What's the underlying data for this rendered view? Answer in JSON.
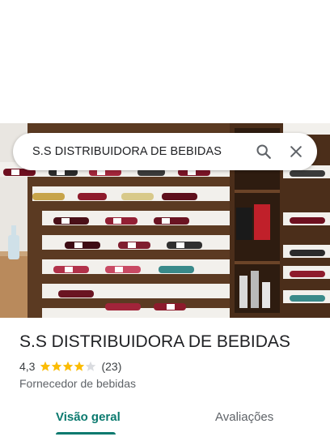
{
  "search": {
    "query": "S.S DISTRIBUIDORA DE BEBIDAS"
  },
  "place": {
    "name": "S.S DISTRIBUIDORA DE BEBIDAS",
    "rating": "4,3",
    "stars": 4.3,
    "review_count": "(23)",
    "category": "Fornecedor de bebidas"
  },
  "tabs": [
    {
      "label": "Visão geral",
      "active": true
    },
    {
      "label": "Avaliações",
      "active": false
    }
  ],
  "colors": {
    "accent": "#0b7a6f",
    "star": "#fbbc04"
  },
  "icons": {
    "search": "search-icon",
    "close": "close-icon"
  }
}
